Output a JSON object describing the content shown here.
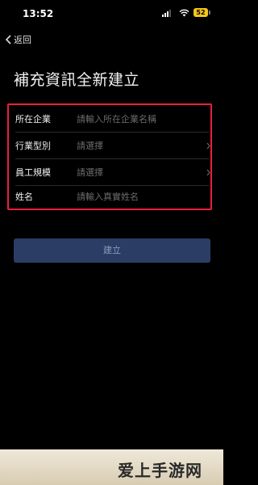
{
  "status_bar": {
    "time": "13:52",
    "battery": "52"
  },
  "nav": {
    "back_label": "返回"
  },
  "page": {
    "title": "補充資訊全新建立"
  },
  "form": {
    "fields": [
      {
        "label": "所在企業",
        "placeholder": "請輸入所在企業名稱",
        "has_chevron": false
      },
      {
        "label": "行業型別",
        "placeholder": "請選擇",
        "has_chevron": true
      },
      {
        "label": "員工規模",
        "placeholder": "請選擇",
        "has_chevron": true
      },
      {
        "label": "姓名",
        "placeholder": "請輸入真實姓名",
        "has_chevron": false
      }
    ]
  },
  "actions": {
    "submit_label": "建立"
  },
  "watermark": {
    "text": "爱上手游网"
  },
  "colors": {
    "highlight": "#e8203c",
    "button_bg": "#2b3d64",
    "battery": "#f5c518"
  }
}
